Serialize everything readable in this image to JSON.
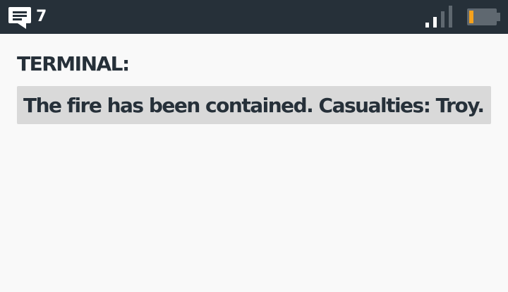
{
  "status_bar": {
    "message_icon": "chat-bubble-icon",
    "message_count": "7",
    "signal_icon": "signal-bars-icon",
    "signal_level": 0.5,
    "battery_icon": "battery-icon",
    "battery_level": 0.15,
    "battery_color": "#f5a11c",
    "background": "#263039"
  },
  "terminal": {
    "label": "TERMINAL:",
    "message": "The fire has been contained. Casualties: Troy."
  }
}
